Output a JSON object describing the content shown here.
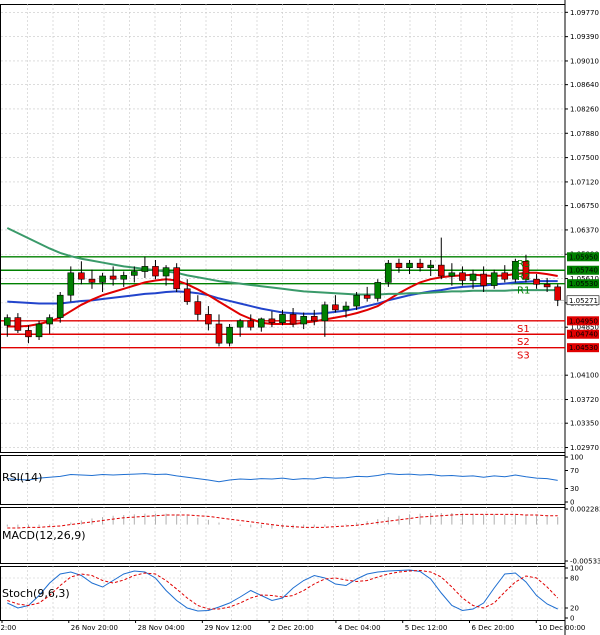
{
  "chart_data": {
    "type": "candlestick",
    "price_axis": {
      "ticks": [
        "1.09770",
        "1.09390",
        "1.09010",
        "1.08640",
        "1.08260",
        "1.07880",
        "1.07500",
        "1.07120",
        "1.06750",
        "1.06370",
        "1.05990",
        "1.05610",
        "1.05230",
        "1.04850",
        "1.04100",
        "1.03720",
        "1.03350",
        "1.02970"
      ],
      "tick_values": [
        1.0977,
        1.0939,
        1.0901,
        1.0864,
        1.0826,
        1.0788,
        1.075,
        1.0712,
        1.0675,
        1.0637,
        1.0599,
        1.0561,
        1.0523,
        1.0485,
        1.041,
        1.0372,
        1.0335,
        1.0297
      ],
      "range": [
        1.029,
        1.099
      ]
    },
    "time_axis": {
      "labels": [
        "12:00",
        "26 Nov 20:00",
        "28 Nov 04:00",
        "29 Nov 12:00",
        "2 Dec 20:00",
        "4 Dec 04:00",
        "5 Dec 12:00",
        "6 Dec 20:00",
        "10 Dec 00:00"
      ]
    },
    "levels": [
      {
        "name": "R3",
        "value": "1.05950",
        "price": 1.0595,
        "color": "#008000"
      },
      {
        "name": "R2",
        "value": "1.05740",
        "price": 1.0574,
        "color": "#008000"
      },
      {
        "name": "R1",
        "value": "1.05530",
        "price": 1.0553,
        "color": "#008000"
      },
      {
        "name": "S1",
        "value": "1.04950",
        "price": 1.0495,
        "color": "#e00000"
      },
      {
        "name": "S2",
        "value": "1.04740",
        "price": 1.0474,
        "color": "#e00000"
      },
      {
        "name": "S3",
        "value": "1.04530",
        "price": 1.0453,
        "color": "#e00000"
      }
    ],
    "current_price": {
      "value": "1.05271",
      "price": 1.05271
    },
    "candles": [
      {
        "o": 1.0488,
        "h": 1.0505,
        "l": 1.047,
        "c": 1.05
      },
      {
        "o": 1.05,
        "h": 1.0507,
        "l": 1.0476,
        "c": 1.048
      },
      {
        "o": 1.048,
        "h": 1.0488,
        "l": 1.046,
        "c": 1.047
      },
      {
        "o": 1.047,
        "h": 1.0495,
        "l": 1.0465,
        "c": 1.049
      },
      {
        "o": 1.049,
        "h": 1.0505,
        "l": 1.0475,
        "c": 1.05
      },
      {
        "o": 1.05,
        "h": 1.054,
        "l": 1.0492,
        "c": 1.0535
      },
      {
        "o": 1.0535,
        "h": 1.058,
        "l": 1.0525,
        "c": 1.057
      },
      {
        "o": 1.057,
        "h": 1.0588,
        "l": 1.0552,
        "c": 1.056
      },
      {
        "o": 1.056,
        "h": 1.0575,
        "l": 1.0545,
        "c": 1.0555
      },
      {
        "o": 1.0555,
        "h": 1.057,
        "l": 1.054,
        "c": 1.0565
      },
      {
        "o": 1.0565,
        "h": 1.058,
        "l": 1.055,
        "c": 1.056
      },
      {
        "o": 1.056,
        "h": 1.0572,
        "l": 1.0548,
        "c": 1.0566
      },
      {
        "o": 1.0566,
        "h": 1.058,
        "l": 1.0555,
        "c": 1.0572
      },
      {
        "o": 1.0572,
        "h": 1.0595,
        "l": 1.0562,
        "c": 1.058
      },
      {
        "o": 1.058,
        "h": 1.059,
        "l": 1.056,
        "c": 1.0565
      },
      {
        "o": 1.0565,
        "h": 1.0582,
        "l": 1.055,
        "c": 1.0578
      },
      {
        "o": 1.0578,
        "h": 1.0585,
        "l": 1.054,
        "c": 1.0545
      },
      {
        "o": 1.0545,
        "h": 1.056,
        "l": 1.052,
        "c": 1.0525
      },
      {
        "o": 1.0525,
        "h": 1.0535,
        "l": 1.0495,
        "c": 1.0505
      },
      {
        "o": 1.0505,
        "h": 1.0518,
        "l": 1.048,
        "c": 1.049
      },
      {
        "o": 1.049,
        "h": 1.0505,
        "l": 1.0455,
        "c": 1.046
      },
      {
        "o": 1.046,
        "h": 1.049,
        "l": 1.0455,
        "c": 1.0485
      },
      {
        "o": 1.0485,
        "h": 1.0498,
        "l": 1.047,
        "c": 1.0495
      },
      {
        "o": 1.0495,
        "h": 1.0505,
        "l": 1.048,
        "c": 1.0485
      },
      {
        "o": 1.0485,
        "h": 1.05,
        "l": 1.0478,
        "c": 1.0498
      },
      {
        "o": 1.0498,
        "h": 1.051,
        "l": 1.0485,
        "c": 1.0492
      },
      {
        "o": 1.0492,
        "h": 1.0512,
        "l": 1.0488,
        "c": 1.0505
      },
      {
        "o": 1.0505,
        "h": 1.0515,
        "l": 1.0485,
        "c": 1.049
      },
      {
        "o": 1.049,
        "h": 1.0508,
        "l": 1.0482,
        "c": 1.0502
      },
      {
        "o": 1.0502,
        "h": 1.0512,
        "l": 1.0488,
        "c": 1.0495
      },
      {
        "o": 1.0495,
        "h": 1.0525,
        "l": 1.047,
        "c": 1.052
      },
      {
        "o": 1.052,
        "h": 1.0535,
        "l": 1.0508,
        "c": 1.0512
      },
      {
        "o": 1.0512,
        "h": 1.0525,
        "l": 1.05,
        "c": 1.0518
      },
      {
        "o": 1.0518,
        "h": 1.054,
        "l": 1.0512,
        "c": 1.0535
      },
      {
        "o": 1.0535,
        "h": 1.0548,
        "l": 1.0525,
        "c": 1.053
      },
      {
        "o": 1.053,
        "h": 1.056,
        "l": 1.0525,
        "c": 1.0555
      },
      {
        "o": 1.0555,
        "h": 1.059,
        "l": 1.0548,
        "c": 1.0585
      },
      {
        "o": 1.0585,
        "h": 1.0592,
        "l": 1.057,
        "c": 1.0578
      },
      {
        "o": 1.0578,
        "h": 1.059,
        "l": 1.0568,
        "c": 1.0585
      },
      {
        "o": 1.0585,
        "h": 1.0592,
        "l": 1.0572,
        "c": 1.0578
      },
      {
        "o": 1.0578,
        "h": 1.059,
        "l": 1.0565,
        "c": 1.0582
      },
      {
        "o": 1.0582,
        "h": 1.0625,
        "l": 1.056,
        "c": 1.0565
      },
      {
        "o": 1.0565,
        "h": 1.0585,
        "l": 1.055,
        "c": 1.057
      },
      {
        "o": 1.057,
        "h": 1.058,
        "l": 1.055,
        "c": 1.0558
      },
      {
        "o": 1.0558,
        "h": 1.0575,
        "l": 1.0545,
        "c": 1.0568
      },
      {
        "o": 1.0568,
        "h": 1.058,
        "l": 1.054,
        "c": 1.055
      },
      {
        "o": 1.055,
        "h": 1.0575,
        "l": 1.0545,
        "c": 1.057
      },
      {
        "o": 1.057,
        "h": 1.0582,
        "l": 1.0555,
        "c": 1.056
      },
      {
        "o": 1.056,
        "h": 1.0592,
        "l": 1.0555,
        "c": 1.0588
      },
      {
        "o": 1.0588,
        "h": 1.0598,
        "l": 1.0555,
        "c": 1.056
      },
      {
        "o": 1.056,
        "h": 1.0568,
        "l": 1.0545,
        "c": 1.0552
      },
      {
        "o": 1.0552,
        "h": 1.0562,
        "l": 1.054,
        "c": 1.0548
      },
      {
        "o": 1.0548,
        "h": 1.0552,
        "l": 1.0518,
        "c": 1.0527
      }
    ],
    "series": [
      {
        "values": [
          1.0525,
          1.0524,
          1.0523,
          1.0522,
          1.0522,
          1.0522,
          1.0524,
          1.0526,
          1.0527,
          1.0529,
          1.0531,
          1.0533,
          1.0535,
          1.0537,
          1.0538,
          1.054,
          1.0541,
          1.054,
          1.0538,
          1.0535,
          1.053,
          1.0526,
          1.0522,
          1.0518,
          1.0514,
          1.0511,
          1.0508,
          1.0507,
          1.0506,
          1.0506,
          1.0507,
          1.0509,
          1.0511,
          1.0514,
          1.0518,
          1.0522,
          1.0527,
          1.0531,
          1.0535,
          1.0538,
          1.0541,
          1.0543,
          1.0546,
          1.0548,
          1.0549,
          1.055,
          1.0552,
          1.0553,
          1.0555,
          1.0556,
          1.0557,
          1.0557,
          1.0557
        ],
        "color": "#2244cc"
      },
      {
        "values": [
          1.0486,
          1.0486,
          1.0487,
          1.049,
          1.0494,
          1.05,
          1.051,
          1.052,
          1.0528,
          1.0535,
          1.054,
          1.0545,
          1.055,
          1.0555,
          1.0558,
          1.056,
          1.0558,
          1.0552,
          1.0544,
          1.0535,
          1.0525,
          1.0515,
          1.0505,
          1.0498,
          1.0492,
          1.049,
          1.049,
          1.049,
          1.0492,
          1.0494,
          1.0497,
          1.05,
          1.0503,
          1.0507,
          1.0512,
          1.0518,
          1.0528,
          1.0538,
          1.0547,
          1.0555,
          1.056,
          1.0563,
          1.0565,
          1.0566,
          1.0567,
          1.0566,
          1.0565,
          1.0566,
          1.0568,
          1.057,
          1.057,
          1.0568,
          1.0565
        ],
        "color": "#e00000"
      },
      {
        "values": [
          1.064,
          1.0632,
          1.0624,
          1.0616,
          1.0608,
          1.0601,
          1.0596,
          1.0592,
          1.0589,
          1.0586,
          1.0583,
          1.058,
          1.0578,
          1.0576,
          1.0574,
          1.0572,
          1.057,
          1.0566,
          1.0563,
          1.056,
          1.0557,
          1.0555,
          1.0553,
          1.0551,
          1.0549,
          1.0547,
          1.0545,
          1.0543,
          1.0541,
          1.054,
          1.0539,
          1.0538,
          1.0537,
          1.0536,
          1.0536,
          1.0536,
          1.0537,
          1.0537,
          1.0538,
          1.0538,
          1.0539,
          1.054,
          1.0541,
          1.0541,
          1.0542,
          1.0542,
          1.0542,
          1.0542,
          1.0543,
          1.0543,
          1.0543,
          1.0543,
          1.0543
        ],
        "color": "#3a9a6a"
      }
    ],
    "indicators": {
      "rsi": {
        "label": "RSI(14)",
        "ticks": [
          "100",
          "70",
          "30",
          "0"
        ],
        "tick_values": [
          100,
          70,
          30,
          0
        ],
        "values": [
          52,
          50,
          49,
          53,
          55,
          57,
          61,
          60,
          59,
          61,
          60,
          61,
          62,
          63,
          61,
          62,
          58,
          55,
          52,
          49,
          45,
          49,
          51,
          50,
          52,
          51,
          53,
          50,
          52,
          51,
          55,
          53,
          54,
          57,
          56,
          59,
          63,
          61,
          62,
          60,
          61,
          58,
          59,
          57,
          58,
          55,
          58,
          56,
          60,
          56,
          53,
          52,
          48
        ],
        "color": "#1f6fd1"
      },
      "macd": {
        "label": "MACD(12,26,9)",
        "ticks": [
          "0.002283",
          "0.0",
          "-0.005335"
        ],
        "tick_values": [
          0.002283,
          0.0,
          -0.005335
        ],
        "histogram": [
          -0.0003,
          -0.0004,
          -0.0004,
          -0.0003,
          -0.0002,
          0.0,
          0.0003,
          0.0006,
          0.0009,
          0.0011,
          0.0013,
          0.0014,
          0.0015,
          0.0016,
          0.0016,
          0.0016,
          0.0015,
          0.0013,
          0.001,
          0.0007,
          0.0003,
          0.0,
          -0.0002,
          -0.0004,
          -0.0005,
          -0.0006,
          -0.0006,
          -0.0006,
          -0.0005,
          -0.0004,
          -0.0003,
          -0.0001,
          0.0001,
          0.0003,
          0.0005,
          0.0008,
          0.0011,
          0.0013,
          0.0015,
          0.0016,
          0.0017,
          0.0017,
          0.0017,
          0.0016,
          0.0016,
          0.0015,
          0.0015,
          0.0014,
          0.0014,
          0.0014,
          0.0013,
          0.0012,
          0.0011
        ],
        "signal": [
          -0.0005,
          -0.0005,
          -0.0004,
          -0.0004,
          -0.0003,
          -0.0002,
          0.0,
          0.0002,
          0.0004,
          0.0006,
          0.0008,
          0.001,
          0.0011,
          0.0012,
          0.0013,
          0.0014,
          0.0014,
          0.0014,
          0.0013,
          0.0012,
          0.001,
          0.0008,
          0.0006,
          0.0004,
          0.0002,
          0.0,
          -0.0002,
          -0.0003,
          -0.0004,
          -0.0004,
          -0.0004,
          -0.0003,
          -0.0002,
          -0.0001,
          0.0001,
          0.0003,
          0.0005,
          0.0007,
          0.0009,
          0.0011,
          0.0012,
          0.0013,
          0.0014,
          0.0015,
          0.0015,
          0.0015,
          0.0015,
          0.0015,
          0.0015,
          0.0014,
          0.0014,
          0.0013,
          0.0013
        ],
        "color": "#e00000"
      },
      "stoch": {
        "label": "Stoch(9,6,3)",
        "ticks": [
          "100",
          "80",
          "20",
          "0"
        ],
        "tick_values": [
          100,
          80,
          20,
          0
        ],
        "main": [
          30,
          20,
          25,
          45,
          70,
          88,
          92,
          85,
          70,
          62,
          75,
          88,
          94,
          92,
          80,
          55,
          35,
          20,
          14,
          15,
          22,
          30,
          42,
          55,
          45,
          35,
          40,
          60,
          75,
          85,
          80,
          68,
          65,
          78,
          88,
          92,
          94,
          95,
          96,
          93,
          78,
          50,
          25,
          15,
          18,
          30,
          60,
          88,
          90,
          72,
          45,
          28,
          18
        ],
        "signal": [
          35,
          28,
          25,
          30,
          45,
          65,
          82,
          88,
          85,
          75,
          70,
          76,
          85,
          90,
          88,
          75,
          58,
          40,
          25,
          18,
          18,
          22,
          30,
          40,
          46,
          45,
          42,
          45,
          55,
          68,
          78,
          80,
          76,
          73,
          75,
          82,
          88,
          92,
          94,
          95,
          92,
          82,
          62,
          40,
          25,
          20,
          30,
          52,
          72,
          84,
          80,
          62,
          40
        ],
        "main_color": "#1f6fd1",
        "signal_color": "#e00000"
      }
    }
  }
}
